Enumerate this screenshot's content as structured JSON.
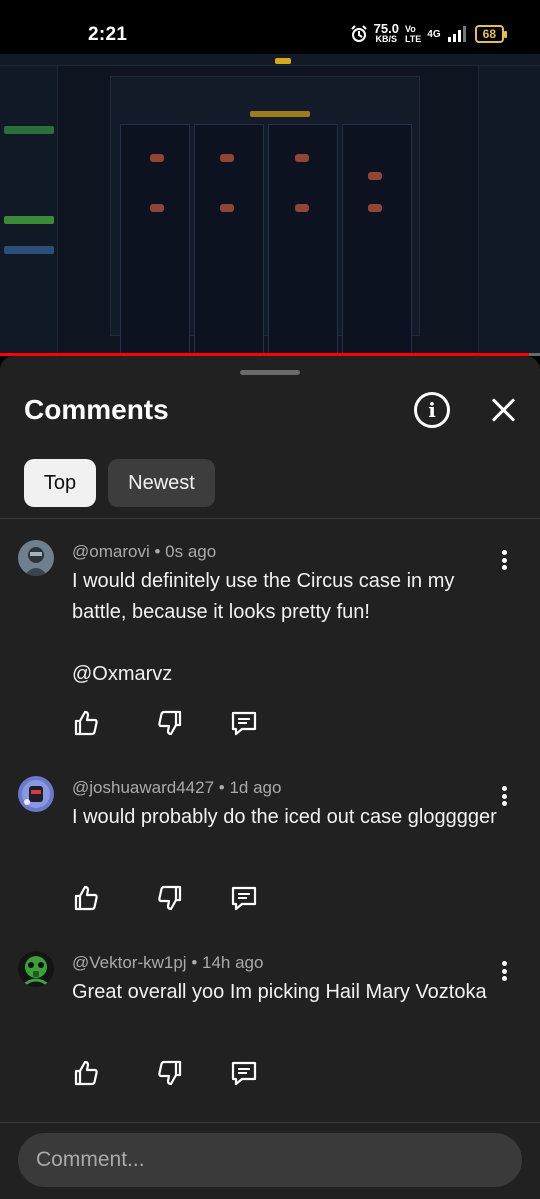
{
  "status_bar": {
    "time": "2:21",
    "net_speed_value": "75.0",
    "net_speed_unit": "KB/S",
    "volte_top": "Vo",
    "volte_bottom": "LTE",
    "network": "4G",
    "battery": "68"
  },
  "video": {
    "progress_fraction": 0.98
  },
  "comments_panel": {
    "title": "Comments",
    "info_icon": "info-icon",
    "close_icon": "close-icon",
    "tabs": [
      {
        "label": "Top",
        "selected": true
      },
      {
        "label": "Newest",
        "selected": false
      }
    ],
    "comments": [
      {
        "author": "@omarovi",
        "time": "0s ago",
        "text": "I would definitely use the Circus case in my battle, because it looks pretty fun!\n\n@Oxmarvz",
        "avatar_icon": "robot-avatar-icon"
      },
      {
        "author": "@joshuaward4427",
        "time": "1d ago",
        "text": "I would probably do the iced out case glogggger",
        "avatar_icon": "character-avatar-icon"
      },
      {
        "author": "@Vektor-kw1pj",
        "time": "14h ago",
        "text": "Great overall yoo Im picking Hail Mary Voztoka",
        "avatar_icon": "gasmask-avatar-icon"
      }
    ],
    "input_placeholder": "Comment..."
  }
}
